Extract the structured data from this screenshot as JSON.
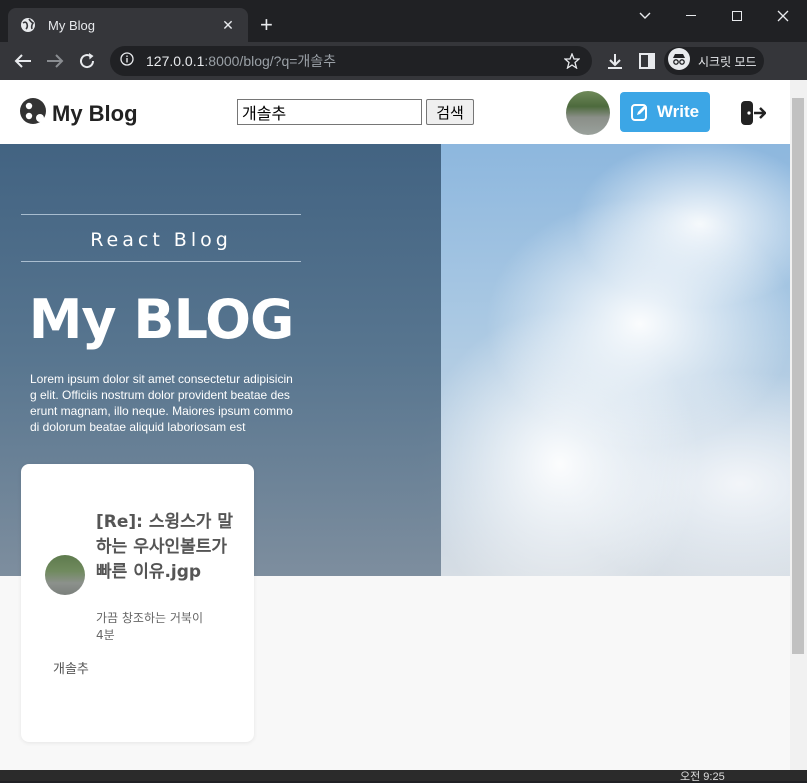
{
  "browser": {
    "tab_title": "My Blog",
    "url_host": "127.0.0.1",
    "url_rest": ":8000/blog/?q=개솔추",
    "incognito_label": "시크릿 모드"
  },
  "header": {
    "brand": "My Blog",
    "search_value": "개솔추",
    "search_button": "검색",
    "write_label": "Write"
  },
  "hero": {
    "subtitle": "React Blog",
    "title": "My BLOG",
    "description": "Lorem ipsum dolor sit amet consectetur adipisicing elit. Officiis nostrum dolor provident beatae deserunt magnam, illo neque. Maiores ipsum commodi dolorum beatae aliquid laboriosam est"
  },
  "posts": [
    {
      "title": "[Re]: 스윙스가 말하는 우사인볼트가 빠른 이유.jgp",
      "author": "가끔 창조하는 거북이",
      "time": "4분",
      "tag": "개솔추"
    }
  ],
  "taskbar": {
    "clock": "오전 9:25"
  }
}
